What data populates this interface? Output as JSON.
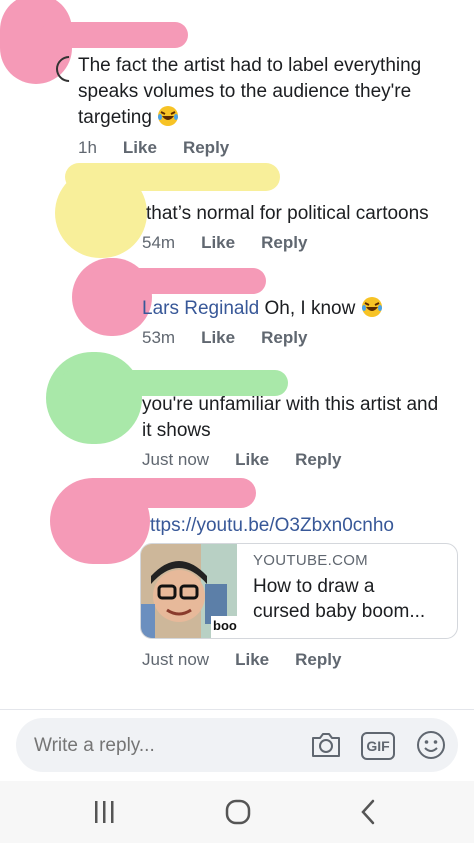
{
  "comments": [
    {
      "text_lines": [
        "The fact the artist had to label everything",
        "speaks volumes to the audience they're",
        "targeting"
      ],
      "time": "1h",
      "like": "Like",
      "reply": "Reply"
    },
    {
      "text": "that’s normal for political cartoons",
      "time": "54m",
      "like": "Like",
      "reply": "Reply"
    },
    {
      "mention": "Lars Reginald",
      "text": "Oh, I know",
      "time": "53m",
      "like": "Like",
      "reply": "Reply"
    },
    {
      "text_lines": [
        "you're unfamiliar with this artist and",
        "it shows"
      ],
      "time": "Just now",
      "like": "Like",
      "reply": "Reply"
    },
    {
      "link": "ttps://youtu.be/O3Zbxn0cnho",
      "card": {
        "domain": "YOUTUBE.COM",
        "title_lines": [
          "How to draw a",
          "cursed baby boom..."
        ],
        "thumb_text": "boo"
      },
      "time": "Just now",
      "like": "Like",
      "reply": "Reply"
    }
  ],
  "composer": {
    "placeholder": "Write a reply...",
    "gif_label": "GIF"
  },
  "colors": {
    "pink": "#f59ab7",
    "yellow": "#f8ef9a",
    "green": "#a9e8a9",
    "link": "#385898"
  }
}
